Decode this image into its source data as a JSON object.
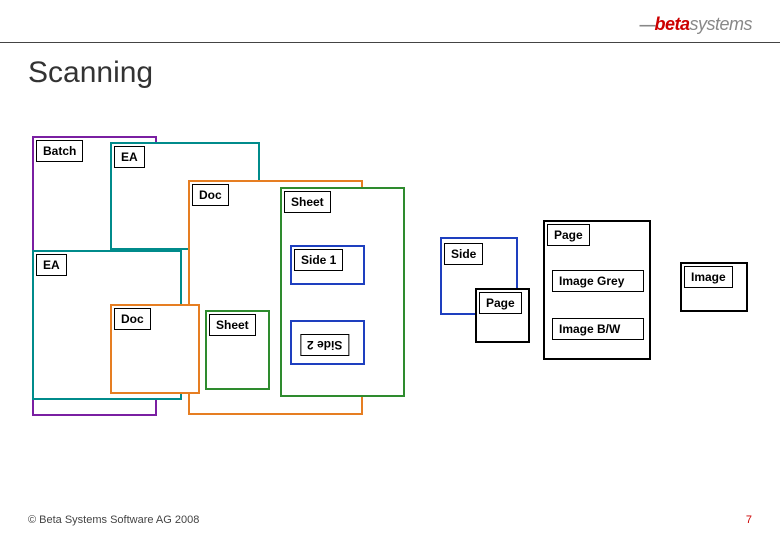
{
  "brand": {
    "dash": "—",
    "beta": "beta",
    "systems": "systems"
  },
  "title": "Scanning",
  "labels": {
    "batch": "Batch",
    "ea1": "EA",
    "ea2": "EA",
    "doc1": "Doc",
    "doc2": "Doc",
    "sheet1": "Sheet",
    "sheet2": "Sheet",
    "side1": "Side 1",
    "side2": "Side 2",
    "side": "Side",
    "page1": "Page",
    "page2": "Page",
    "imageGrey": "Image Grey",
    "imageBW": "Image B/W",
    "image": "Image"
  },
  "colors": {
    "purple": "#7a1fa2",
    "teal": "#008b8b",
    "orange": "#e67e22",
    "green": "#2e8b2e",
    "blue": "#1e3fbf",
    "black": "#000000"
  },
  "footer": {
    "copyright": "© Beta Systems Software AG 2008",
    "page": "7"
  }
}
